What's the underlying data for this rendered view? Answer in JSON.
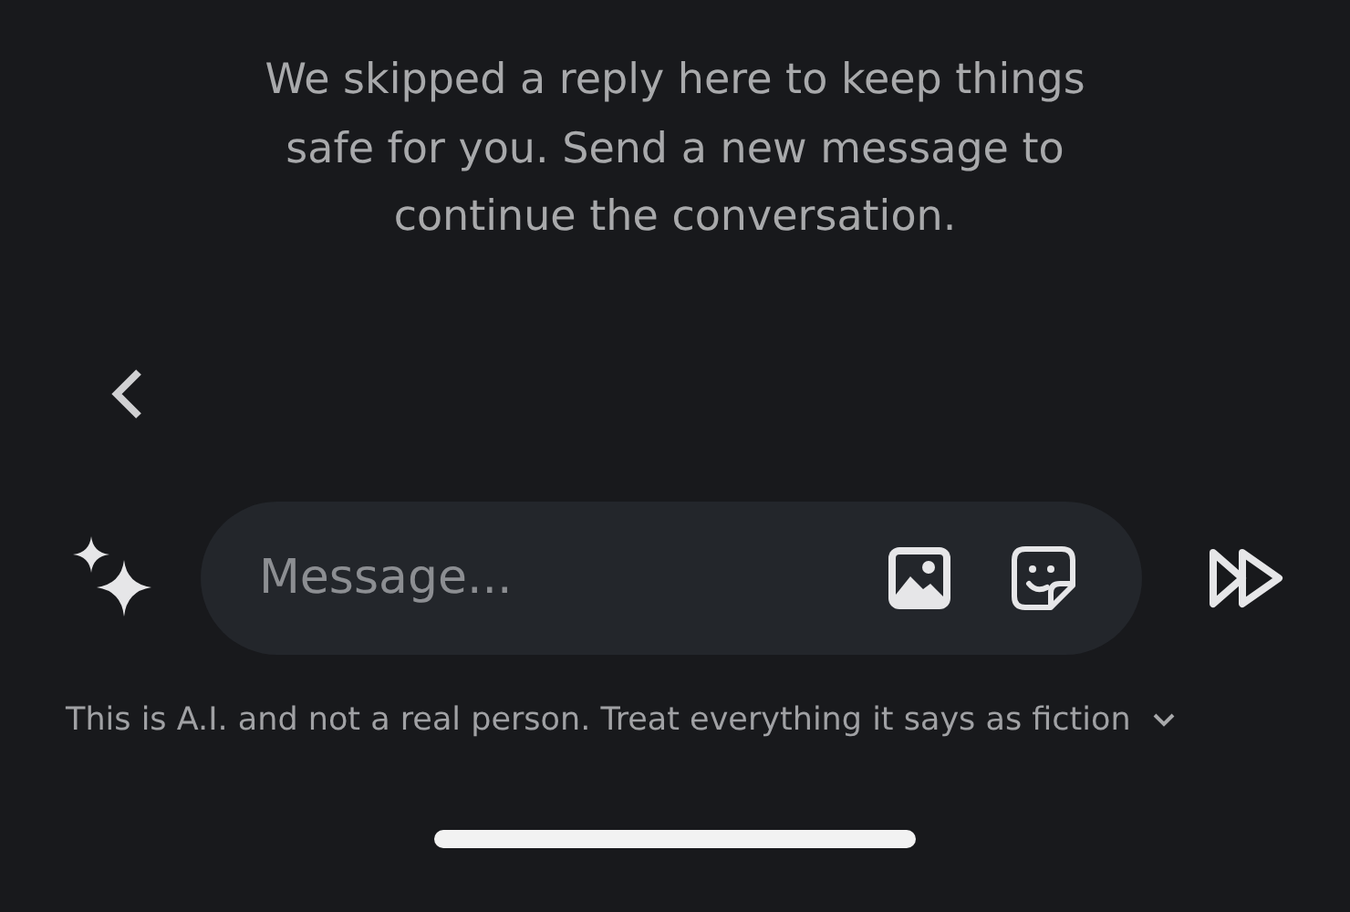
{
  "notice": "We skipped a reply here to keep things safe for you. Send a new message to continue the conversation.",
  "composer": {
    "placeholder": "Message..."
  },
  "disclaimer": "This is A.I. and not a real person. Treat everything it says as fiction"
}
